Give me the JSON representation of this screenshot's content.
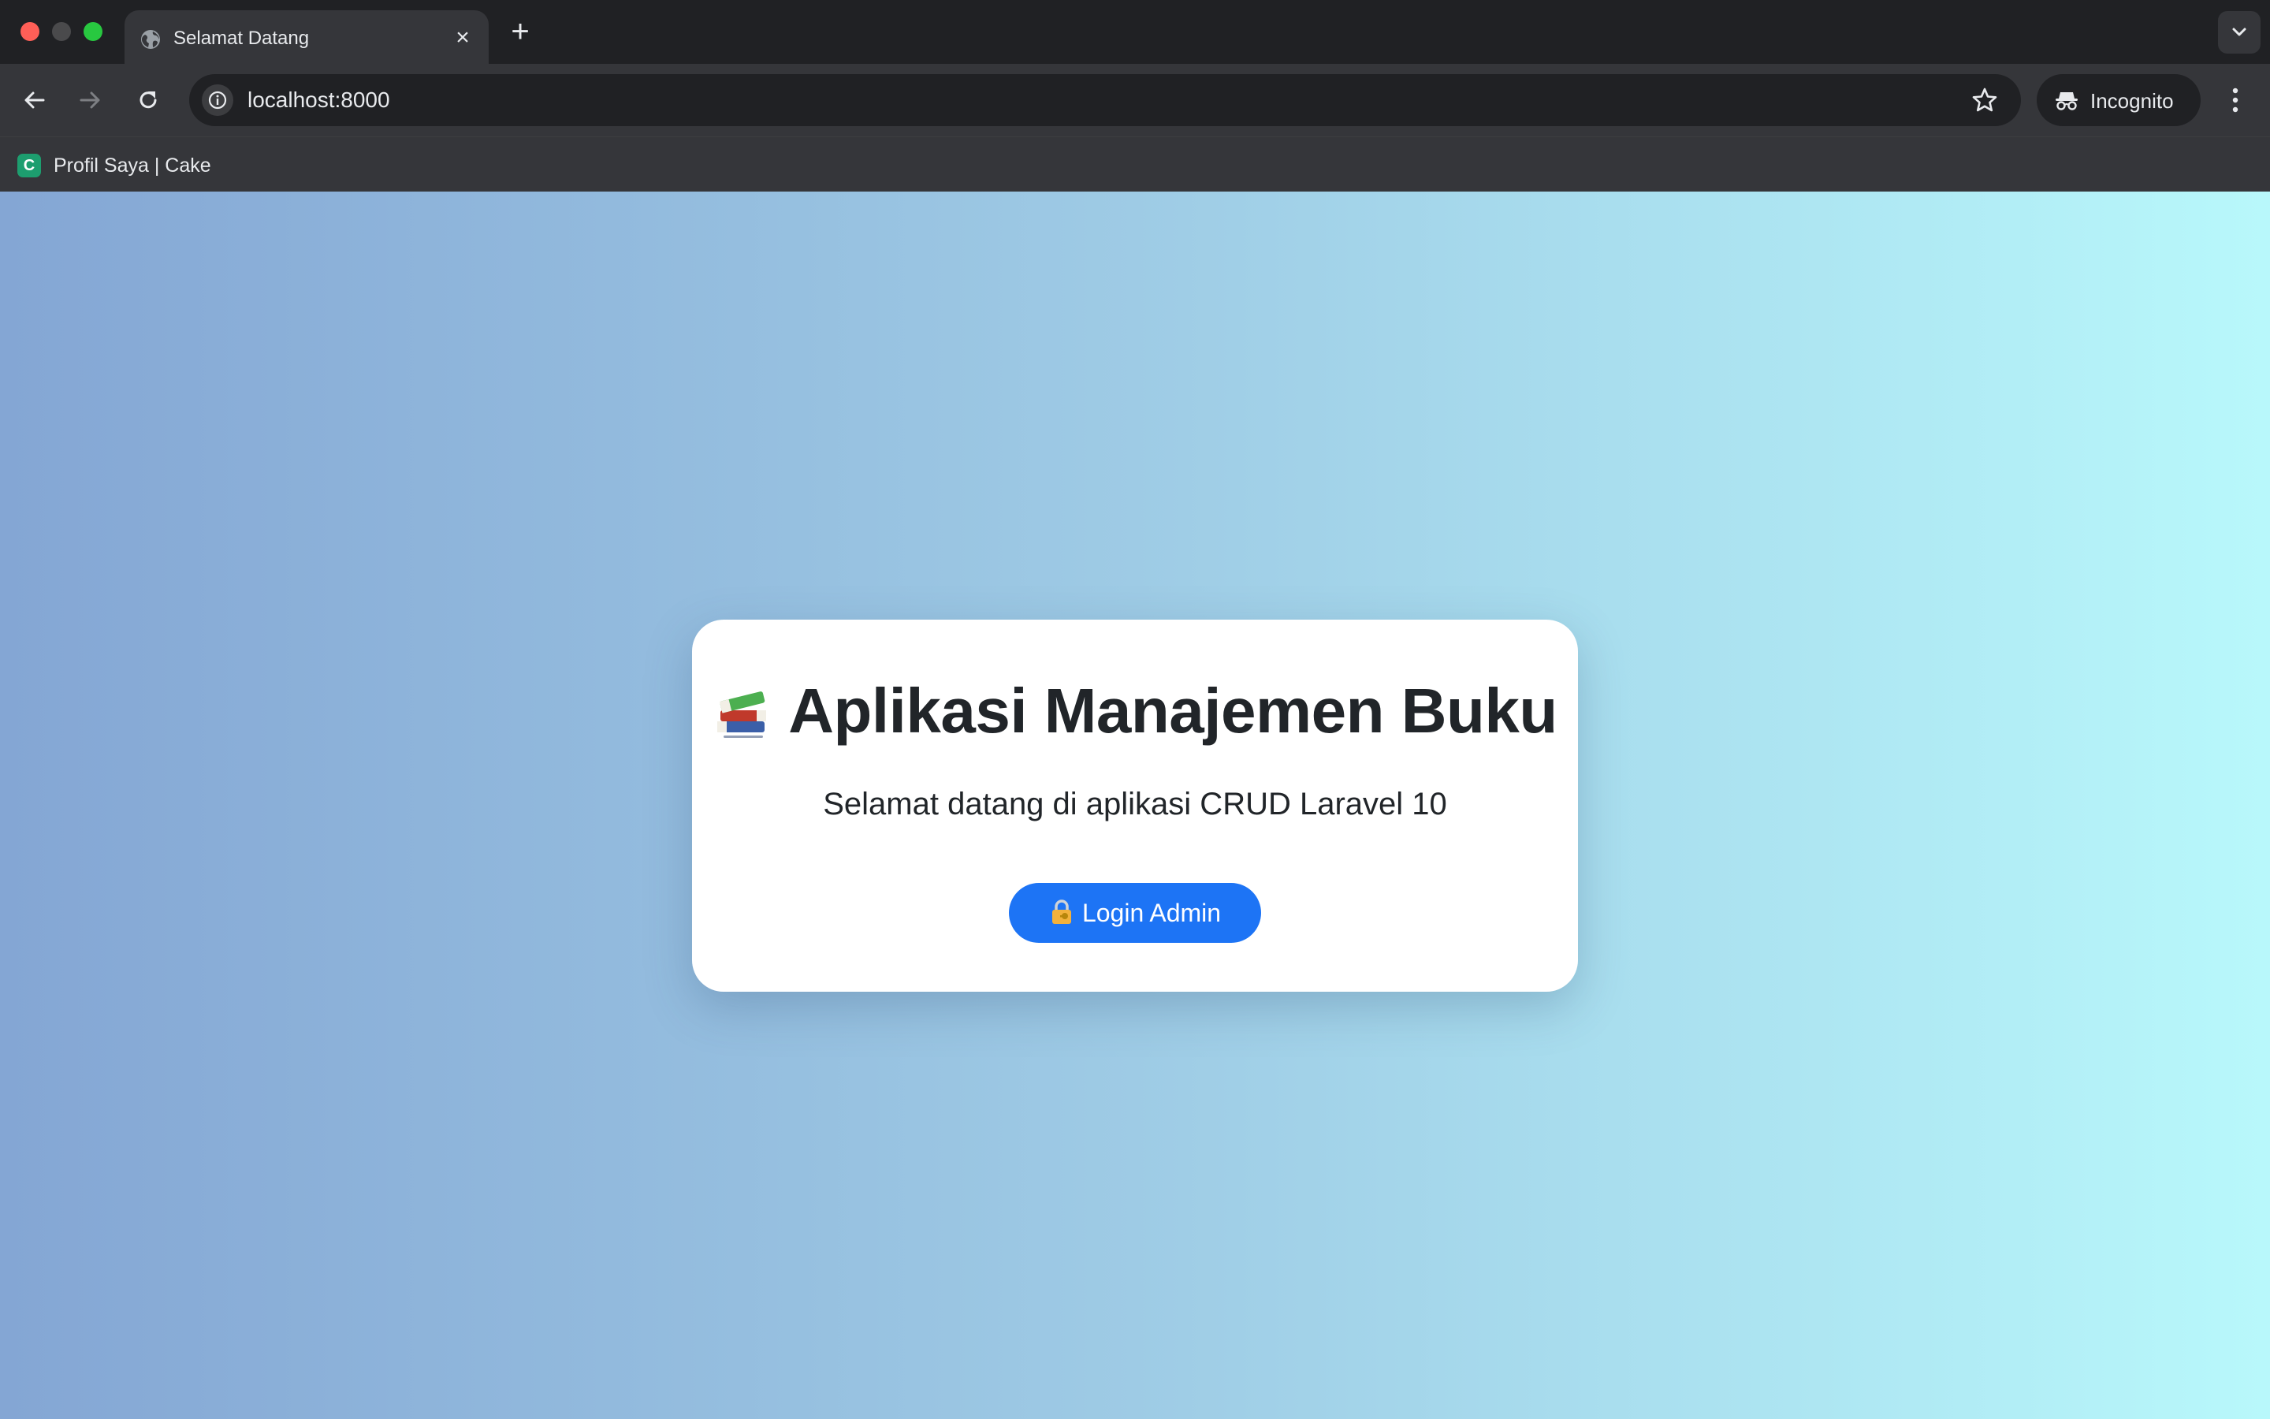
{
  "browser": {
    "tab_title": "Selamat Datang",
    "url": "localhost:8000",
    "incognito_label": "Incognito",
    "bookmark": {
      "icon_letter": "C",
      "label": "Profil Saya | Cake"
    }
  },
  "page": {
    "title": "Aplikasi Manajemen Buku",
    "subtitle": "Selamat datang di aplikasi CRUD Laravel 10",
    "login_button": "Login Admin",
    "icons": {
      "title_icon": "books-icon",
      "button_icon": "lock-key-icon"
    }
  },
  "colors": {
    "primary_button": "#1d74f5",
    "gradient_start": "#84a6d4",
    "gradient_end": "#b8f8fb"
  }
}
